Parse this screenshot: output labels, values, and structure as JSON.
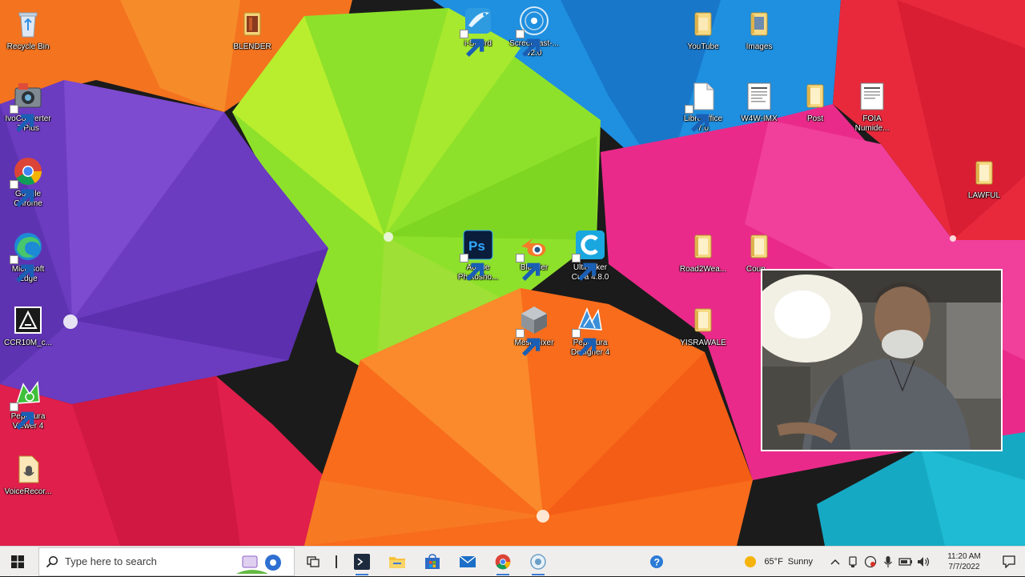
{
  "desktop": {
    "icons": [
      {
        "id": "recycle-bin",
        "label": "Recycle Bin"
      },
      {
        "id": "blender-folder",
        "label": "BLENDER"
      },
      {
        "id": "iswordfish",
        "label": "i-Sword"
      },
      {
        "id": "screencast",
        "label": "Screencast-...\nv2.0"
      },
      {
        "id": "youtube-folder",
        "label": "YouTube"
      },
      {
        "id": "images-folder",
        "label": "Images"
      },
      {
        "id": "ivoconverter",
        "label": "IvoConverter\n7 Plus"
      },
      {
        "id": "libreoffice",
        "label": "LibreOffice\n7.0"
      },
      {
        "id": "wpimx",
        "label": "W4W-IMX"
      },
      {
        "id": "post-folder",
        "label": "Post"
      },
      {
        "id": "foia",
        "label": "FOIA\nNumide..."
      },
      {
        "id": "chrome",
        "label": "Google\nChrome"
      },
      {
        "id": "lawful-folder",
        "label": "LAWFUL"
      },
      {
        "id": "edge",
        "label": "Microsoft\nEdge"
      },
      {
        "id": "photoshop",
        "label": "Adobe\nPhotosho..."
      },
      {
        "id": "blender-app",
        "label": "Blender"
      },
      {
        "id": "cura",
        "label": "Ultimaker\nCura 4.8.0"
      },
      {
        "id": "folder-road",
        "label": "Road2Wea..."
      },
      {
        "id": "folder-coun",
        "label": "Coun..."
      },
      {
        "id": "ccr",
        "label": "CCR10M_c..."
      },
      {
        "id": "meshmixer",
        "label": "Meshmixer"
      },
      {
        "id": "pepakura-designer",
        "label": "Pepakura\nDesigner 4"
      },
      {
        "id": "yisrawale",
        "label": "YISRAWALE"
      },
      {
        "id": "pepakura-viewer",
        "label": "Pepakura\nViewer 4"
      },
      {
        "id": "voicerecorder",
        "label": "VoiceRecor..."
      }
    ]
  },
  "taskbar": {
    "search_placeholder": "Type here to search",
    "weather_temp": "65°F",
    "weather_desc": "Sunny",
    "time": "11:20 AM",
    "date": "7/7/2022"
  },
  "colors": {
    "taskbar_bg": "#f0eeec",
    "accent": "#3a7bd5"
  }
}
